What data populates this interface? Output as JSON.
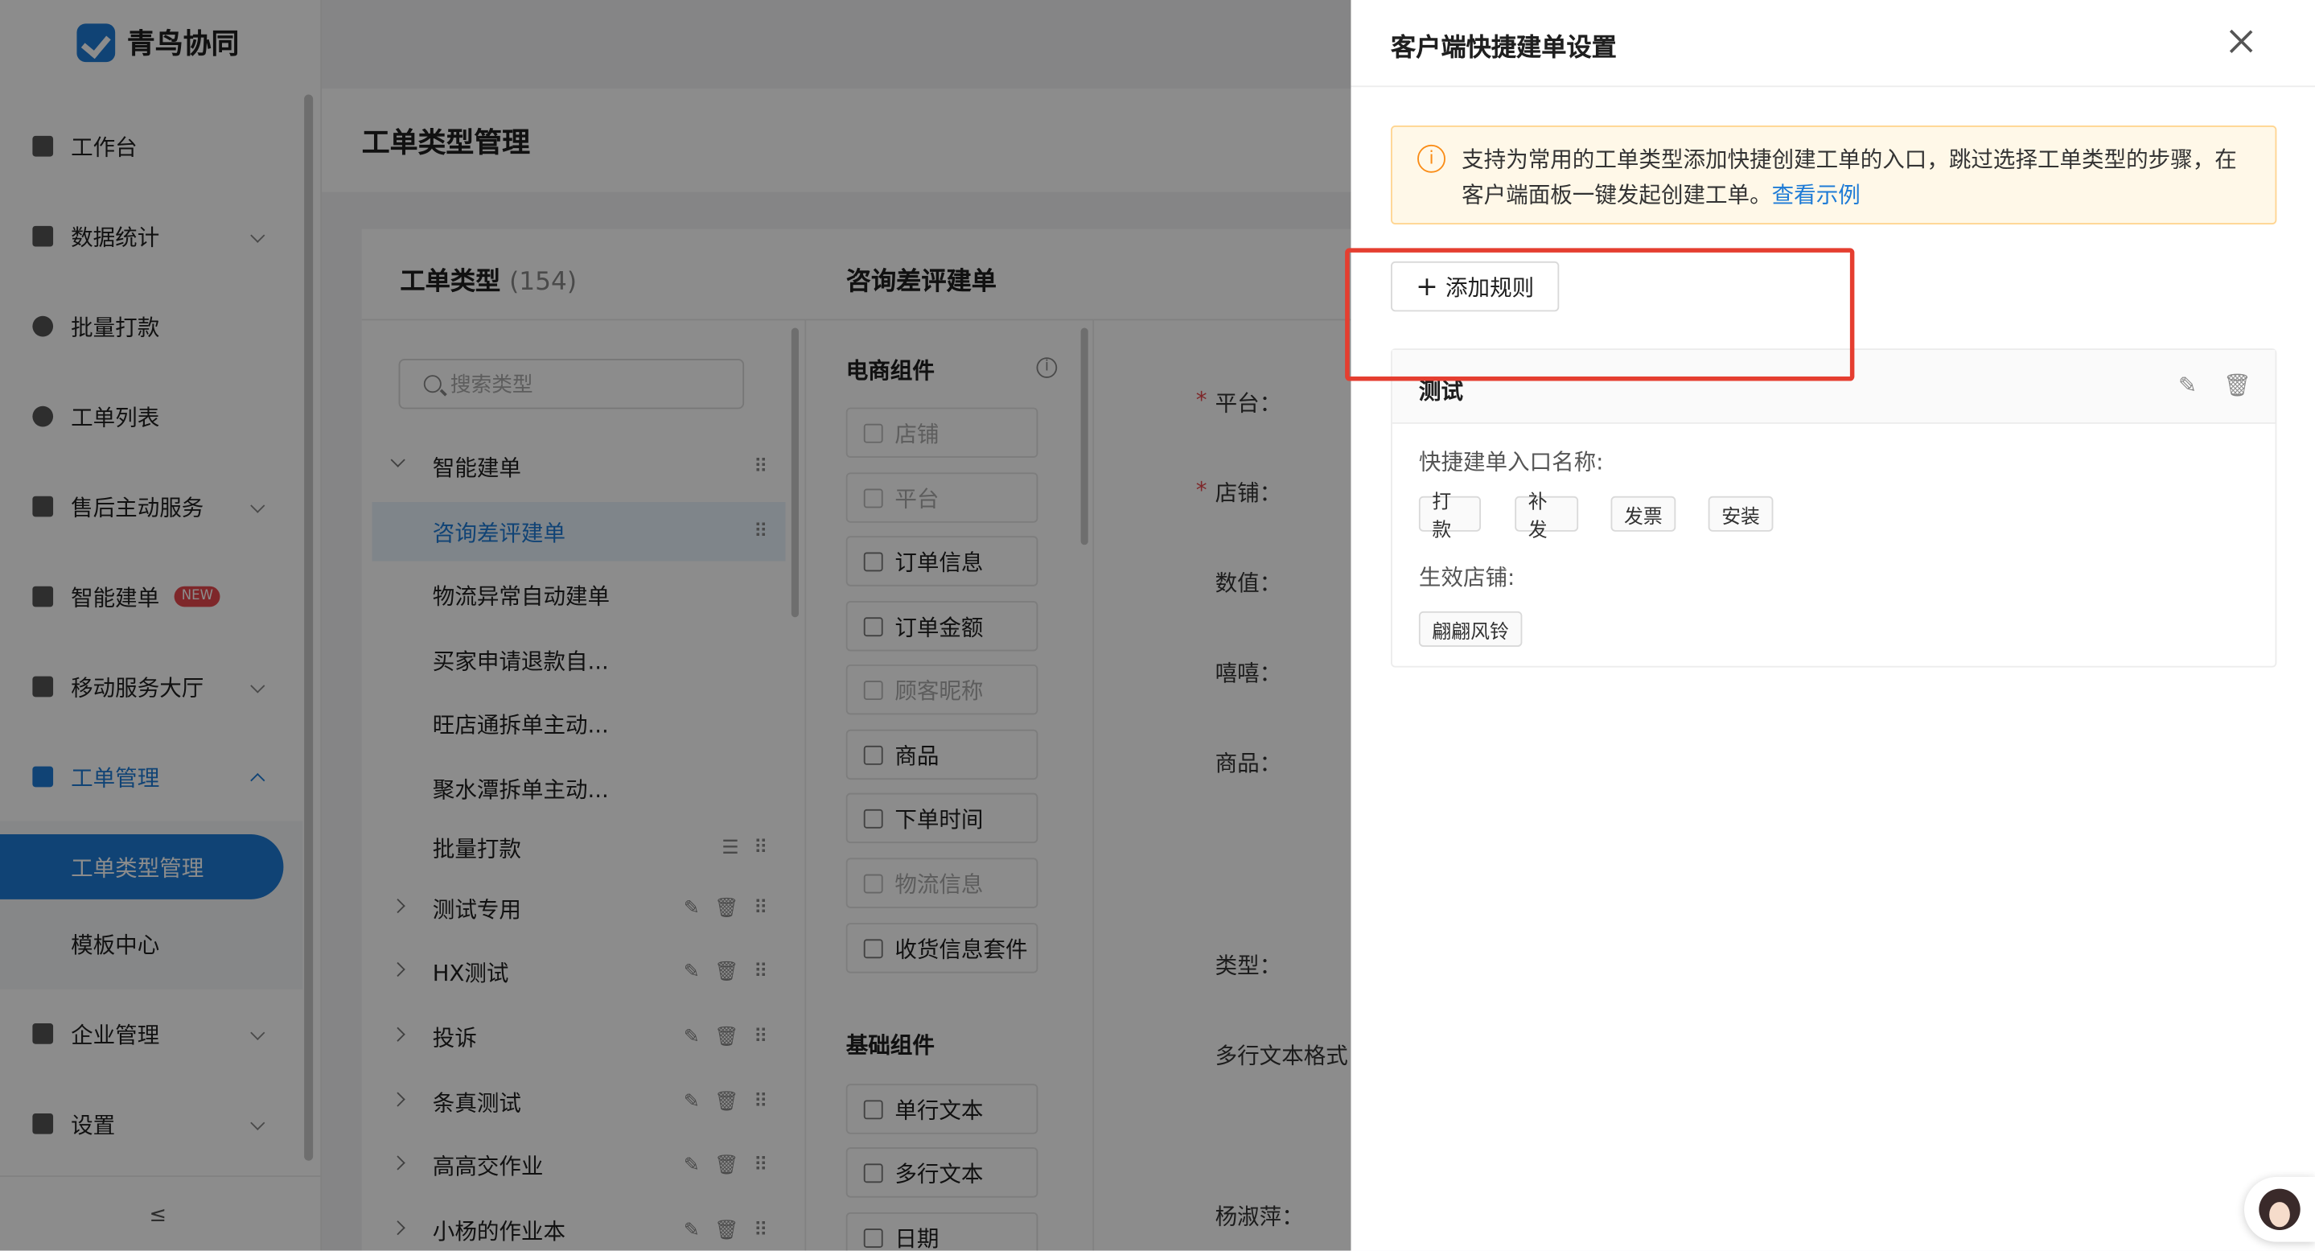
{
  "app": {
    "name": "青鸟协同"
  },
  "sidebar": {
    "items": [
      {
        "label": "工作台"
      },
      {
        "label": "数据统计"
      },
      {
        "label": "批量打款"
      },
      {
        "label": "工单列表"
      },
      {
        "label": "售后主动服务"
      },
      {
        "label": "智能建单",
        "badge": "NEW"
      },
      {
        "label": "移动服务大厅"
      },
      {
        "label": "工单管理"
      },
      {
        "label": "企业管理"
      },
      {
        "label": "设置"
      }
    ],
    "subitems": [
      {
        "label": "工单类型管理"
      },
      {
        "label": "模板中心"
      }
    ],
    "collapse_icon": "≤"
  },
  "page": {
    "title": "工单类型管理"
  },
  "types_panel": {
    "title": "工单类型",
    "count": "(154)",
    "search_placeholder": "搜索类型",
    "tree": [
      {
        "label": "智能建单"
      },
      {
        "label": "咨询差评建单"
      },
      {
        "label": "物流异常自动建单"
      },
      {
        "label": "买家申请退款自..."
      },
      {
        "label": "旺店通拆单主动..."
      },
      {
        "label": "聚水潭拆单主动..."
      },
      {
        "label": "批量打款"
      },
      {
        "label": "测试专用"
      },
      {
        "label": "HX测试"
      },
      {
        "label": "投诉"
      },
      {
        "label": "条真测试"
      },
      {
        "label": "高高交作业"
      },
      {
        "label": "小杨的作业本"
      }
    ]
  },
  "components_panel": {
    "title": "咨询差评建单",
    "ecom_group": "电商组件",
    "ecom": [
      {
        "label": "店铺"
      },
      {
        "label": "平台"
      },
      {
        "label": "订单信息"
      },
      {
        "label": "订单金额"
      },
      {
        "label": "顾客昵称"
      },
      {
        "label": "商品"
      },
      {
        "label": "下单时间"
      },
      {
        "label": "物流信息"
      },
      {
        "label": "收货信息套件"
      }
    ],
    "basic_group": "基础组件",
    "basic": [
      {
        "label": "单行文本"
      },
      {
        "label": "多行文本"
      },
      {
        "label": "日期"
      }
    ]
  },
  "form_preview": {
    "labels": [
      {
        "label": "平台："
      },
      {
        "label": "店铺："
      },
      {
        "label": "数值："
      },
      {
        "label": "嘻嘻："
      },
      {
        "label": "商品："
      },
      {
        "label": "类型："
      },
      {
        "label": "多行文本格式"
      },
      {
        "label": "杨淑萍："
      }
    ]
  },
  "drawer": {
    "title": "客户端快捷建单设置",
    "alert_text": "支持为常用的工单类型添加快捷创建工单的入口，跳过选择工单类型的步骤，在客户端面板一键发起创建工单。",
    "alert_link": "查看示例",
    "add_rule": "添加规则",
    "rule": {
      "name": "测试",
      "entry_label": "快捷建单入口名称:",
      "entries": [
        "打款",
        "补发",
        "发票",
        "安装"
      ],
      "shop_label": "生效店铺:",
      "shops": [
        "翩翩风铃"
      ]
    }
  },
  "colors": {
    "accent": "#1e7bd6",
    "highlight": "#e53e30",
    "warning": "#fa8c16"
  }
}
